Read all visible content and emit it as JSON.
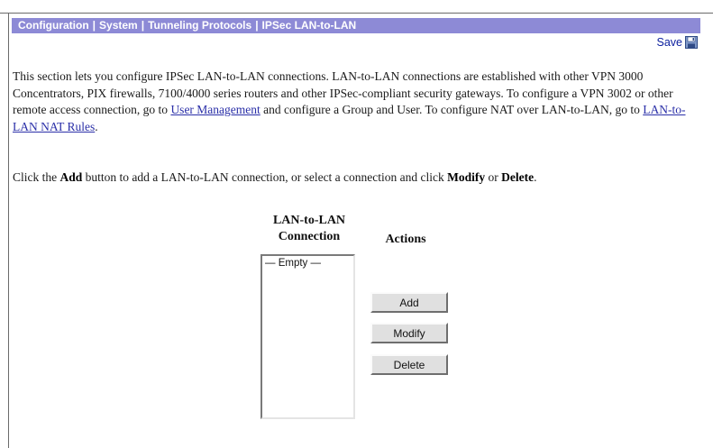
{
  "header": {
    "breadcrumb": [
      "Configuration",
      "System",
      "Tunneling Protocols",
      "IPSec LAN-to-LAN"
    ],
    "separator": "|",
    "save_label": "Save",
    "bar_color": "#8d8ad6",
    "save_icon": "floppy-disk-icon"
  },
  "intro": {
    "text1": "This section lets you configure IPSec LAN-to-LAN connections. LAN-to-LAN connections are established with other VPN 3000 Concentrators, PIX firewalls, 7100/4000 series routers and other IPSec-compliant security gateways. To configure a VPN 3002 or other remote access connection, go to ",
    "link1": "User Management",
    "text2": " and configure a Group and User. To configure NAT over LAN-to-LAN, go to ",
    "link2": "LAN-to-LAN NAT Rules",
    "text3": "."
  },
  "instruction": {
    "part1": "Click the ",
    "add_word": "Add",
    "part2": " button to add a LAN-to-LAN connection, or select a connection and click ",
    "modify_word": "Modify",
    "part3": " or ",
    "delete_word": "Delete",
    "part4": "."
  },
  "connections": {
    "header_line1": "LAN-to-LAN",
    "header_line2": "Connection",
    "list": [
      "— Empty —"
    ]
  },
  "actions": {
    "header": "Actions",
    "add": "Add",
    "modify": "Modify",
    "delete": "Delete"
  }
}
